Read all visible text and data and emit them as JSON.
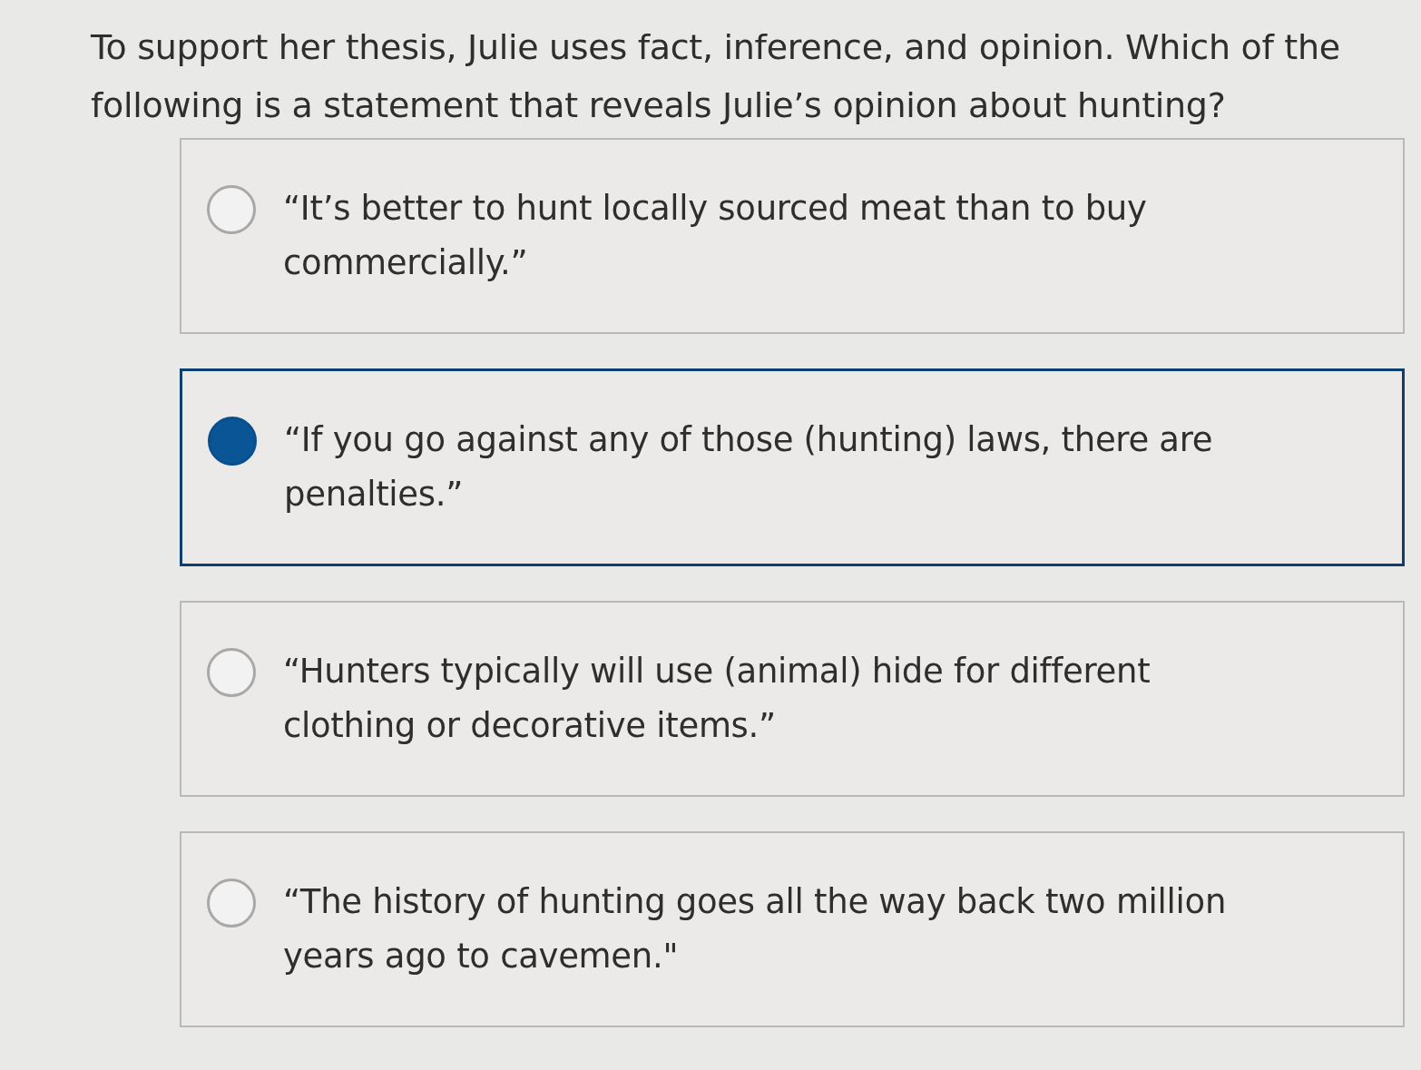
{
  "question": "To support her thesis, Julie uses fact, inference, and opinion. Which of the following is a statement that reveals Julie’s opinion about hunting?",
  "options": [
    {
      "text": "“It’s better to hunt locally sourced meat than to buy commercially.”",
      "selected": false
    },
    {
      "text": "“If you go against any of those (hunting) laws, there are penalties.”",
      "selected": true
    },
    {
      "text": "“Hunters typically will use (animal) hide for different clothing or decorative items.”",
      "selected": false
    },
    {
      "text": "“The history of hunting goes all the way back two million years ago to cavemen.\"",
      "selected": false
    }
  ]
}
